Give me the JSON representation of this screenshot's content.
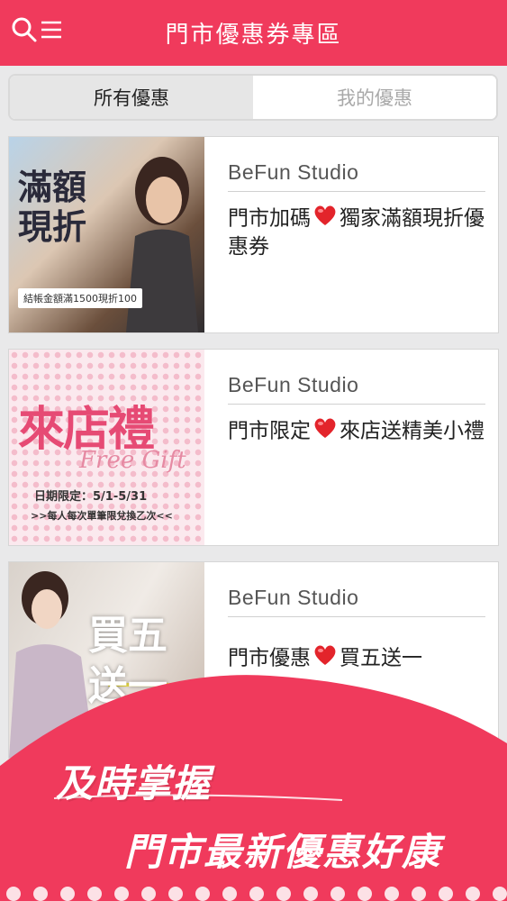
{
  "header": {
    "title": "門市優惠券專區",
    "search_icon": "search-icon",
    "menu_icon": "menu-icon",
    "bg_color": "#f03a5c"
  },
  "tabs": [
    {
      "label": "所有優惠",
      "active": true
    },
    {
      "label": "我的優惠",
      "active": false
    }
  ],
  "coupons": [
    {
      "store": "BeFun Studio",
      "desc_before": "門市加碼",
      "desc_after": "獨家滿額現折優惠券",
      "image_text": "滿額現折",
      "image_note": "結帳金額滿1500現折100"
    },
    {
      "store": "BeFun Studio",
      "desc_before": "門市限定",
      "desc_after": "來店送精美小禮",
      "image_text": "來店禮",
      "image_sub": "Free Gift",
      "image_note1": "日期限定：5/1-5/31",
      "image_note2": ">>每人每次單筆限兌換乙次<<"
    },
    {
      "store": "BeFun Studio",
      "desc_before": "門市優惠",
      "desc_after": "買五送一",
      "image_text": "買五送一"
    }
  ],
  "promo": {
    "line1": "及時掌握",
    "line2": "門市最新優惠好康",
    "bg_color": "#f03a5c"
  }
}
